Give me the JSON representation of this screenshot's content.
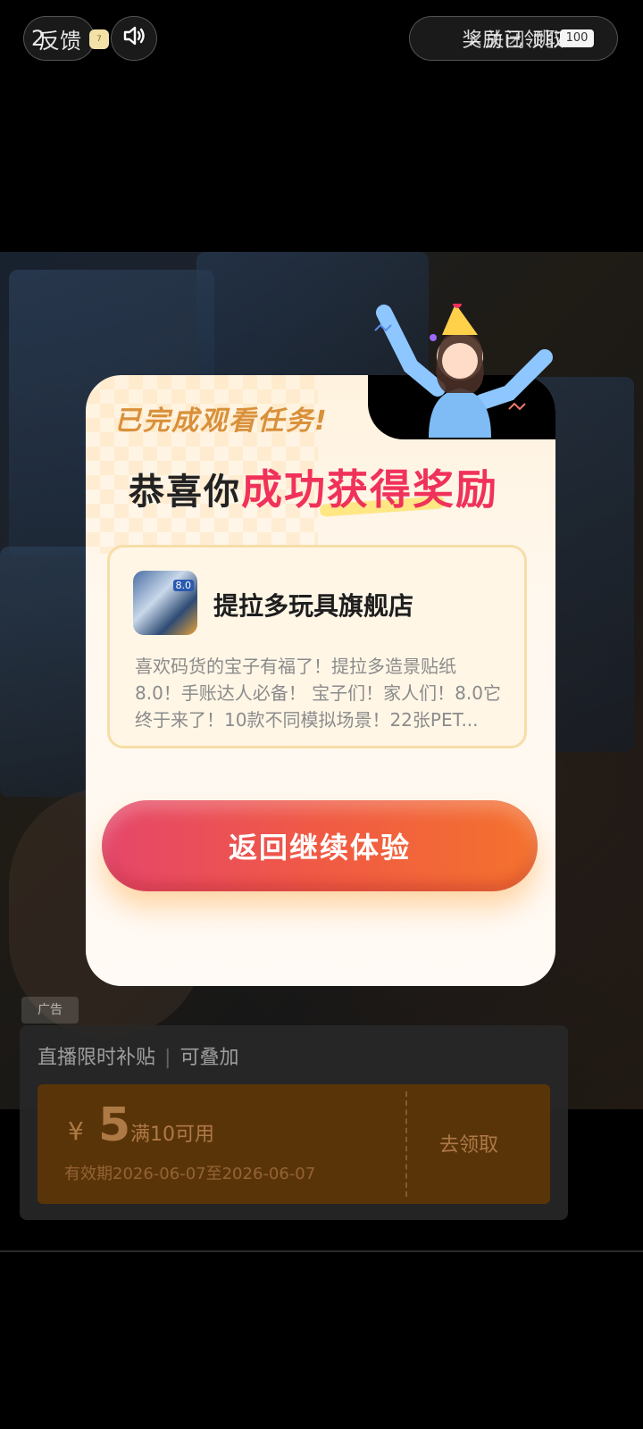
{
  "top_bar": {
    "feedback_count": "2",
    "feedback_label": "反馈",
    "sticker_text": "7",
    "reward_text_1": "奖励已领取",
    "reward_text_2": "×关闭 跳过",
    "reward_badge": "100"
  },
  "dialog": {
    "task_title": "已完成观看任务!",
    "congrats_prefix": "恭喜你",
    "congrats_highlight": "成功获得奖励",
    "store_name": "提拉多玩具旗舰店",
    "store_icon_tag": "8.0",
    "store_description": "喜欢码货的宝子有福了！提拉多造景贴纸8.0！手账达人必备！ 宝子们！家人们！8.0它终于来了！10款不同模拟场景！22张PET...",
    "cta_label": "返回继续体验"
  },
  "ad": {
    "tag": "广告",
    "coupon_header_left": "直播限时补贴",
    "coupon_header_right": "可叠加",
    "coupon_currency": "¥",
    "coupon_value": "5",
    "coupon_condition": "满10可用",
    "coupon_validity": "有效期2026-06-07至2026-06-07",
    "coupon_claim": "去领取"
  },
  "colors": {
    "accent_red": "#f0325a",
    "cta_gradient_start": "#e5466a",
    "cta_gradient_end": "#f4722e",
    "task_title_color": "#d9903a"
  }
}
